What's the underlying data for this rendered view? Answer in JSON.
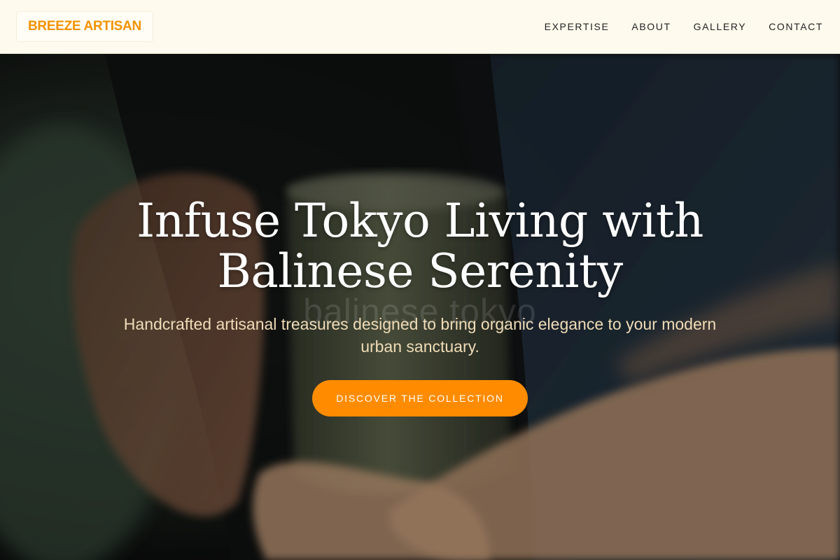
{
  "header": {
    "logo": "BREEZE ARTISAN",
    "nav": [
      "EXPERTISE",
      "ABOUT",
      "GALLERY",
      "CONTACT"
    ]
  },
  "hero": {
    "title_line1": "Infuse Tokyo Living with",
    "title_line2": "Balinese Serenity",
    "watermark": "balinese tokyo",
    "subtitle": "Handcrafted artisanal treasures designed to bring organic elegance to your modern urban sanctuary.",
    "cta": "DISCOVER THE COLLECTION"
  },
  "colors": {
    "accent": "#ff8c00",
    "logo": "#f39200",
    "header_bg": "#fefaed",
    "subtitle": "#f0dcb8"
  }
}
